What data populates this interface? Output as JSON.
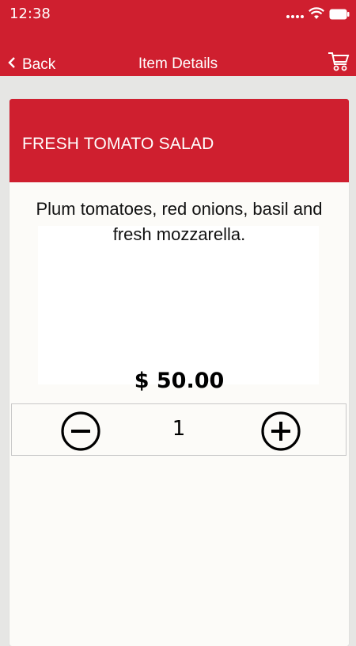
{
  "status_bar": {
    "time": "12:38",
    "icons": [
      "signal-dots-icon",
      "wifi-icon",
      "battery-icon"
    ]
  },
  "nav": {
    "back_label": "Back",
    "title": "Item Details",
    "cart_icon": "cart-icon"
  },
  "item": {
    "name": "FRESH TOMATO SALAD",
    "description": "Plum tomatoes, red onions, basil and fresh mozzarella.",
    "price": "$ 50.00",
    "quantity": "1"
  },
  "colors": {
    "brand_red": "#cf1f2f",
    "card_bg": "#fcfbf8",
    "page_bg": "#e6e6e4"
  }
}
